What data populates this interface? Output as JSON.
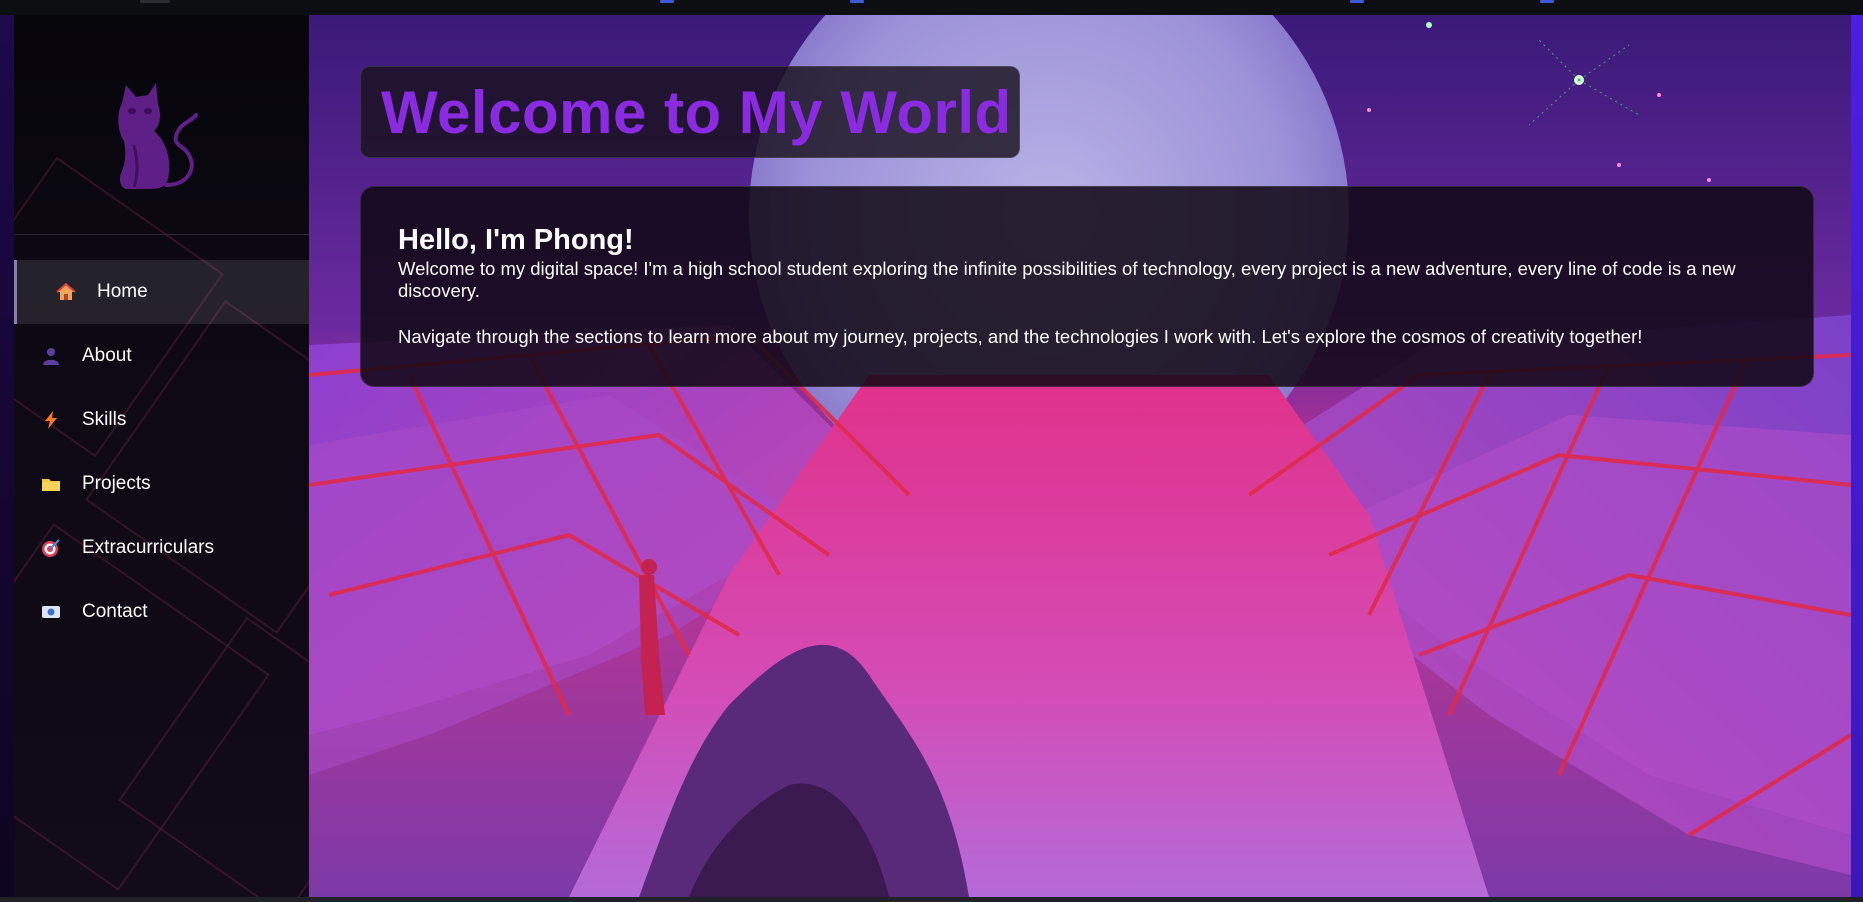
{
  "sidebar": {
    "logo_icon": "cat-icon",
    "items": [
      {
        "label": "Home",
        "icon": "house-icon",
        "active": true
      },
      {
        "label": "About",
        "icon": "person-icon",
        "active": false
      },
      {
        "label": "Skills",
        "icon": "lightning-icon",
        "active": false
      },
      {
        "label": "Projects",
        "icon": "folder-icon",
        "active": false
      },
      {
        "label": "Extracurriculars",
        "icon": "target-icon",
        "active": false
      },
      {
        "label": "Contact",
        "icon": "id-card-icon",
        "active": false
      }
    ]
  },
  "main": {
    "title": "Welcome to My World",
    "intro": {
      "heading": "Hello, I'm Phong!",
      "paragraph1": "Welcome to my digital space! I'm a high school student exploring the infinite possibilities of technology, every project is a new adventure, every line of code is a new discovery.",
      "paragraph2": "Navigate through the sections to learn more about my journey, projects, and the technologies I work with. Let's explore the cosmos of creativity together!"
    }
  },
  "colors": {
    "title": "#8a2be2",
    "accent_right_edge": "#4b1fe0",
    "text": "#ffffff"
  }
}
